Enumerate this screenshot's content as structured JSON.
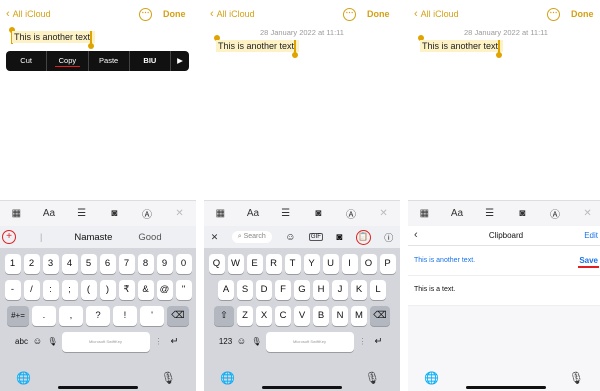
{
  "nav": {
    "back_label": "All iCloud",
    "more_label": "⋯",
    "done_label": "Done"
  },
  "note": {
    "text": "This is another text.",
    "date": "28 January 2022 at 11:11"
  },
  "edit_menu": {
    "cut": "Cut",
    "copy": "Copy",
    "paste": "Paste",
    "format": "BIU",
    "next": "▶"
  },
  "toolbar": {
    "table": "▦",
    "format": "Aa",
    "checklist": "☰",
    "camera": "◙",
    "markup": "Ⓐ",
    "close": "✕"
  },
  "predictions": {
    "add": "+",
    "divider": "|",
    "word1": "Namaste",
    "word2": "Good"
  },
  "clipboard_bar": {
    "close": "✕",
    "search": "Search",
    "emoji": "☺",
    "gif": "GIF",
    "camera": "◙",
    "clipboard": "📋",
    "info": "ⓘ"
  },
  "clipboard": {
    "back": "‹",
    "title": "Clipboard",
    "edit": "Edit",
    "save": "Save",
    "items": [
      "This is another text.",
      "This is a text."
    ]
  },
  "keyboard_numbers": {
    "row1": [
      "1",
      "2",
      "3",
      "4",
      "5",
      "6",
      "7",
      "8",
      "9",
      "0"
    ],
    "row2": [
      "-",
      "/",
      ":",
      ";",
      "(",
      ")",
      "₹",
      "&",
      "@",
      "\""
    ],
    "row3_left": "#+=",
    "row3": [
      ".",
      ",",
      "?",
      "!",
      "'"
    ],
    "backspace": "⌫",
    "mode": "abc",
    "emoji": "☺",
    "mic": "🎙",
    "space_label": "Microsoft SwiftKey",
    "return": "↵",
    "globe": "🌐"
  },
  "keyboard_letters": {
    "row1": [
      "Q",
      "W",
      "E",
      "R",
      "T",
      "Y",
      "U",
      "I",
      "O",
      "P"
    ],
    "row2": [
      "A",
      "S",
      "D",
      "F",
      "G",
      "H",
      "J",
      "K",
      "L"
    ],
    "shift": "⇧",
    "row3": [
      "Z",
      "X",
      "C",
      "V",
      "B",
      "N",
      "M"
    ],
    "mode": "123"
  },
  "colors": {
    "accent": "#d4a017",
    "highlight": "#fdf1c6",
    "callout": "#e02020",
    "link": "#1a73e8"
  }
}
